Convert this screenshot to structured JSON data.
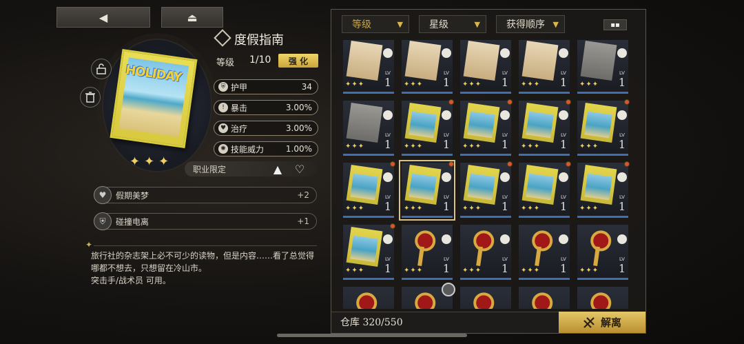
{
  "nav": {
    "back_icon": "◀",
    "home_icon": "⏏"
  },
  "item": {
    "name": "度假指南",
    "cover_text": "HOLIDAY",
    "level_label": "等级",
    "level_value": "1/10",
    "enhance_label": "强 化",
    "stars": 3,
    "stats": [
      {
        "name": "护甲",
        "value": "34",
        "icon": "shield-icon"
      },
      {
        "name": "暴击",
        "value": "3.00%",
        "icon": "crit-icon"
      },
      {
        "name": "治疗",
        "value": "3.00%",
        "icon": "heal-icon"
      },
      {
        "name": "技能威力",
        "value": "1.00%",
        "icon": "skill-icon"
      }
    ],
    "class_limit_label": "职业限定",
    "perks": [
      {
        "name": "假期美梦",
        "value": "+2"
      },
      {
        "name": "碰撞电离",
        "value": "+1"
      }
    ],
    "description": "旅行社的杂志架上必不可少的读物，但是内容……看了总觉得哪都不想去，只想留在冷山市。",
    "usable_by": "突击手/战术员 可用。"
  },
  "filters": {
    "level": "等级",
    "star": "星级",
    "order": "获得顺序"
  },
  "inventory": {
    "lv_label": "LV",
    "cards": [
      {
        "art": "paper",
        "stars": 3,
        "level": "1"
      },
      {
        "art": "paper",
        "stars": 3,
        "level": "1"
      },
      {
        "art": "paper",
        "stars": 3,
        "level": "1"
      },
      {
        "art": "paper",
        "stars": 3,
        "level": "1"
      },
      {
        "art": "gray",
        "stars": 3,
        "level": "1"
      },
      {
        "art": "gray",
        "stars": 3,
        "level": "1"
      },
      {
        "art": "magazine",
        "stars": 3,
        "level": "1",
        "dot": true
      },
      {
        "art": "magazine",
        "stars": 3,
        "level": "1",
        "dot": true
      },
      {
        "art": "magazine",
        "stars": 3,
        "level": "1",
        "dot": true
      },
      {
        "art": "magazine",
        "stars": 3,
        "level": "1",
        "dot": true
      },
      {
        "art": "magazine",
        "stars": 3,
        "level": "1",
        "dot": true
      },
      {
        "art": "magazine",
        "stars": 3,
        "level": "1",
        "selected": true,
        "dot": true
      },
      {
        "art": "magazine",
        "stars": 3,
        "level": "1",
        "dot": true
      },
      {
        "art": "magazine",
        "stars": 3,
        "level": "1",
        "dot": true
      },
      {
        "art": "magazine",
        "stars": 3,
        "level": "1",
        "dot": true
      },
      {
        "art": "magazine",
        "stars": 3,
        "level": "1",
        "dot": true
      },
      {
        "art": "key",
        "stars": 3,
        "level": "1"
      },
      {
        "art": "key",
        "stars": 3,
        "level": "1"
      },
      {
        "art": "key",
        "stars": 3,
        "level": "1"
      },
      {
        "art": "key",
        "stars": 3,
        "level": "1"
      },
      {
        "art": "key",
        "stars": 0,
        "level": ""
      },
      {
        "art": "key",
        "stars": 0,
        "level": "",
        "avatar": true
      },
      {
        "art": "key",
        "stars": 0,
        "level": ""
      },
      {
        "art": "key",
        "stars": 0,
        "level": ""
      },
      {
        "art": "key",
        "stars": 0,
        "level": ""
      }
    ]
  },
  "footer": {
    "storage": "仓库 320/550",
    "dismantle_label": "解离"
  }
}
